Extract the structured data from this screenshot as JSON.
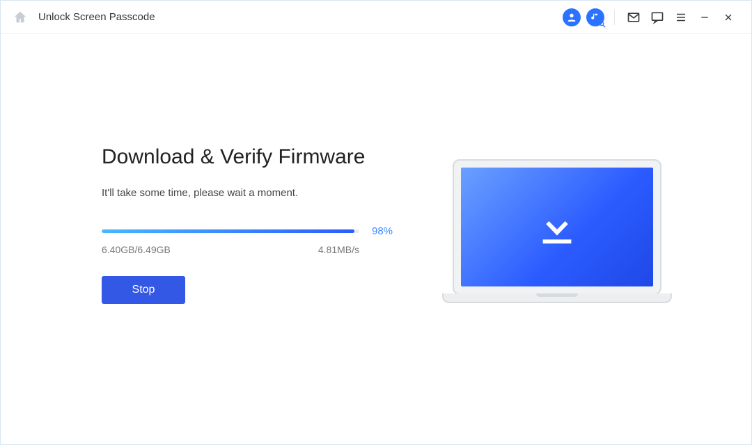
{
  "header": {
    "title": "Unlock Screen Passcode"
  },
  "main": {
    "heading": "Download & Verify Firmware",
    "subtext": "It'll take some time, please wait a moment.",
    "progress_percent": 98,
    "progress_label": "98%",
    "size_label": "6.40GB/6.49GB",
    "speed_label": "4.81MB/s",
    "stop_label": "Stop"
  }
}
